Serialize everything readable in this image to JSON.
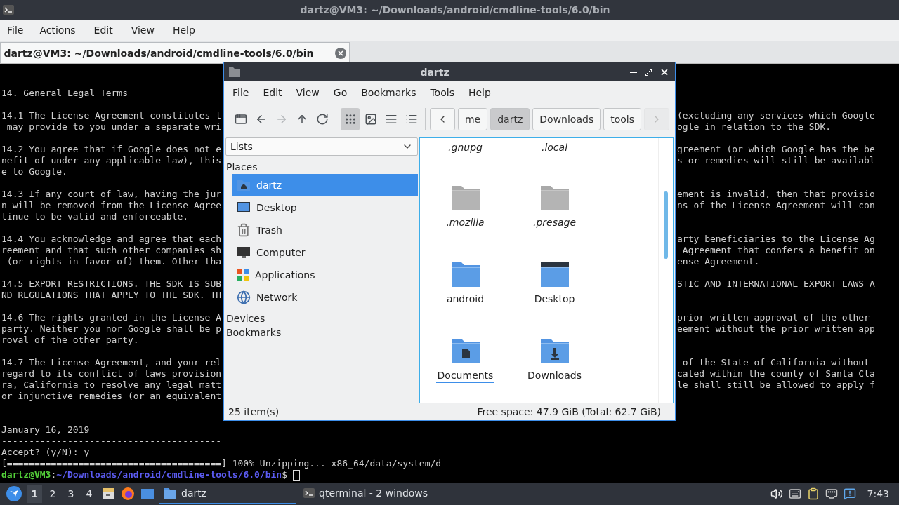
{
  "terminal_window": {
    "title": "dartz@VM3: ~/Downloads/android/cmdline-tools/6.0/bin",
    "menu": [
      "File",
      "Actions",
      "Edit",
      "View",
      "Help"
    ],
    "tabs": [
      {
        "label": "dartz@VM3: ~/Downloads/android/cmdline-tools/6.0/bin",
        "selected": true
      }
    ],
    "lines": [
      {
        "kind": "text",
        "text": "14. General Legal Terms"
      },
      {
        "kind": "blank"
      },
      {
        "kind": "text",
        "text": "14.1 The License Agreement constitutes t",
        "right": "(excluding any services which Google"
      },
      {
        "kind": "text",
        "text": " may provide to you under a separate wri",
        "right": "ogle in relation to the SDK."
      },
      {
        "kind": "blank"
      },
      {
        "kind": "text",
        "text": "14.2 You agree that if Google does not e",
        "right": "greement (or which Google has the be"
      },
      {
        "kind": "text",
        "text": "nefit of under any applicable law), this",
        "right": "s or remedies will still be availabl"
      },
      {
        "kind": "text",
        "text": "e to Google."
      },
      {
        "kind": "blank"
      },
      {
        "kind": "text",
        "text": "14.3 If any court of law, having the jur",
        "right": "ement is invalid, then that provisio"
      },
      {
        "kind": "text",
        "text": "n will be removed from the License Agree",
        "right": "ns of the License Agreement will con"
      },
      {
        "kind": "text",
        "text": "tinue to be valid and enforceable."
      },
      {
        "kind": "blank"
      },
      {
        "kind": "text",
        "text": "14.4 You acknowledge and agree that each",
        "right": "arty beneficiaries to the License Ag"
      },
      {
        "kind": "text",
        "text": "reement and that such other companies sh",
        "right": " Agreement that confers a benefit on"
      },
      {
        "kind": "text",
        "text": " (or rights in favor of) them. Other tha",
        "right": "ense Agreement."
      },
      {
        "kind": "blank"
      },
      {
        "kind": "text",
        "text": "14.5 EXPORT RESTRICTIONS. THE SDK IS SUB",
        "right": "STIC AND INTERNATIONAL EXPORT LAWS A"
      },
      {
        "kind": "text",
        "text": "ND REGULATIONS THAT APPLY TO THE SDK. TH"
      },
      {
        "kind": "blank"
      },
      {
        "kind": "text",
        "text": "14.6 The rights granted in the License A",
        "right": "prior written approval of the other"
      },
      {
        "kind": "text",
        "text": "party. Neither you nor Google shall be p",
        "right": "eement without the prior written app"
      },
      {
        "kind": "text",
        "text": "roval of the other party."
      },
      {
        "kind": "blank"
      },
      {
        "kind": "text",
        "text": "14.7 The License Agreement, and your rel",
        "right": " of the State of California without"
      },
      {
        "kind": "text",
        "text": "regard to its conflict of laws provision",
        "right": "cated within the county of Santa Cla"
      },
      {
        "kind": "text",
        "text": "ra, California to resolve any legal matt",
        "right": "le shall still be allowed to apply f"
      },
      {
        "kind": "text",
        "text": "or injunctive remedies (or an equivalent"
      },
      {
        "kind": "blank"
      },
      {
        "kind": "blank"
      },
      {
        "kind": "text",
        "text": "January 16, 2019"
      },
      {
        "kind": "text",
        "text": "----------------------------------------"
      },
      {
        "kind": "text",
        "text": "Accept? (y/N): y"
      },
      {
        "kind": "text",
        "text": "[=======================================] 100% Unzipping... x86_64/data/system/d"
      }
    ],
    "prompt": {
      "user_host": "dartz@VM3",
      "separator": ":",
      "path": "~/Downloads/android/cmdline-tools/6.0/bin",
      "symbol": "$"
    }
  },
  "file_manager": {
    "title": "dartz",
    "menu": [
      "File",
      "Edit",
      "View",
      "Go",
      "Bookmarks",
      "Tools",
      "Help"
    ],
    "toolbar": [
      {
        "kind": "new-tab",
        "disabled": false
      },
      {
        "kind": "back",
        "disabled": false
      },
      {
        "kind": "forward",
        "disabled": true
      },
      {
        "kind": "up",
        "disabled": false
      },
      {
        "kind": "reload",
        "disabled": false
      }
    ],
    "view_modes": [
      {
        "kind": "icons",
        "selected": true
      },
      {
        "kind": "thumbnails",
        "selected": false
      },
      {
        "kind": "compact",
        "selected": false
      },
      {
        "kind": "details",
        "selected": false
      }
    ],
    "path_scroll": [
      {
        "kind": "left",
        "disabled": false
      },
      {
        "kind": "right",
        "disabled": true
      }
    ],
    "path": [
      {
        "label": "me",
        "selected": false
      },
      {
        "label": "dartz",
        "selected": true
      },
      {
        "label": "Downloads",
        "selected": false
      },
      {
        "label": "tools",
        "selected": false
      }
    ],
    "side_pane": {
      "mode": "Lists",
      "sections": [
        {
          "label": "Places",
          "items": [
            {
              "label": "dartz",
              "kind": "home",
              "selected": true
            },
            {
              "label": "Desktop",
              "kind": "desktop",
              "selected": false
            },
            {
              "label": "Trash",
              "kind": "trash",
              "selected": false
            },
            {
              "label": "Computer",
              "kind": "computer",
              "selected": false
            },
            {
              "label": "Applications",
              "kind": "applications",
              "selected": false
            },
            {
              "label": "Network",
              "kind": "network",
              "selected": false
            }
          ]
        },
        {
          "label": "Devices"
        },
        {
          "label": "Bookmarks"
        }
      ]
    },
    "files": [
      {
        "name": ".gnupg",
        "kind": "cut",
        "hidden": true,
        "focused": false
      },
      {
        "name": ".local",
        "kind": "cut",
        "hidden": true,
        "focused": false
      },
      {
        "name": ".mozilla",
        "kind": "folder",
        "hidden": true,
        "focused": false
      },
      {
        "name": ".presage",
        "kind": "folder",
        "hidden": true,
        "focused": false
      },
      {
        "name": "android",
        "kind": "folder",
        "hidden": false,
        "focused": false
      },
      {
        "name": "Desktop",
        "kind": "desktop",
        "hidden": false,
        "focused": false
      },
      {
        "name": "Documents",
        "kind": "documents",
        "hidden": false,
        "focused": true
      },
      {
        "name": "Downloads",
        "kind": "downloads",
        "hidden": false,
        "focused": false
      }
    ],
    "status": {
      "items": "25 item(s)",
      "free_space": "Free space: 47.9 GiB (Total: 62.7 GiB)"
    }
  },
  "taskbar": {
    "workspaces": [
      {
        "label": "1",
        "selected": true
      },
      {
        "label": "2",
        "selected": false
      },
      {
        "label": "3",
        "selected": false
      },
      {
        "label": "4",
        "selected": false
      }
    ],
    "launchers": [
      {
        "kind": "files"
      },
      {
        "kind": "browser"
      },
      {
        "kind": "desktop"
      }
    ],
    "tasks": [
      {
        "label": "dartz",
        "kind": "folder",
        "selected": true
      },
      {
        "label": "qterminal - 2 windows",
        "kind": "terminal",
        "selected": false
      }
    ],
    "tray": [
      {
        "kind": "volume"
      },
      {
        "kind": "keyboard"
      },
      {
        "kind": "clipboard"
      },
      {
        "kind": "network"
      },
      {
        "kind": "notification"
      }
    ],
    "clock": "7:43"
  }
}
